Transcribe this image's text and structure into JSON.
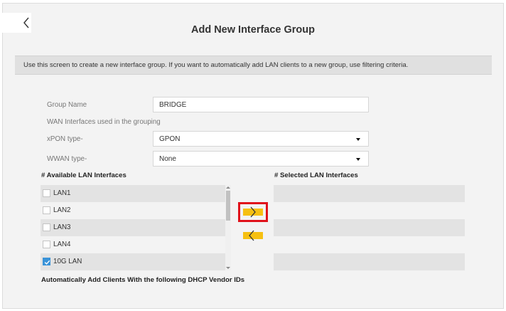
{
  "page": {
    "title": "Add New Interface Group",
    "description": "Use this screen to create a new interface group. If you want to automatically add LAN clients to a new group, use filtering criteria."
  },
  "form": {
    "group_name_label": "Group Name",
    "group_name_value": "BRIDGE",
    "wan_caption": "WAN Interfaces used in the grouping",
    "xpon_label": "xPON type-",
    "xpon_value": "GPON",
    "wwan_label": "WWAN type-",
    "wwan_value": "None"
  },
  "available": {
    "heading": "# Available LAN Interfaces",
    "items": [
      {
        "label": "LAN1",
        "checked": false
      },
      {
        "label": "LAN2",
        "checked": false
      },
      {
        "label": "LAN3",
        "checked": false
      },
      {
        "label": "LAN4",
        "checked": false
      },
      {
        "label": "10G LAN",
        "checked": true
      }
    ]
  },
  "selected": {
    "heading": "# Selected LAN Interfaces"
  },
  "dhcp": {
    "heading": "Automatically Add Clients With the following DHCP Vendor IDs"
  },
  "icons": {
    "back": "chevron-left-icon",
    "move_right": "chevron-right-icon",
    "move_left": "chevron-left-icon",
    "dropdown": "caret-down-icon",
    "check": "checkmark-icon"
  },
  "colors": {
    "accent_yellow": "#f6c011",
    "highlight_red": "#e0121b",
    "checkbox_blue": "#3a93d8"
  }
}
